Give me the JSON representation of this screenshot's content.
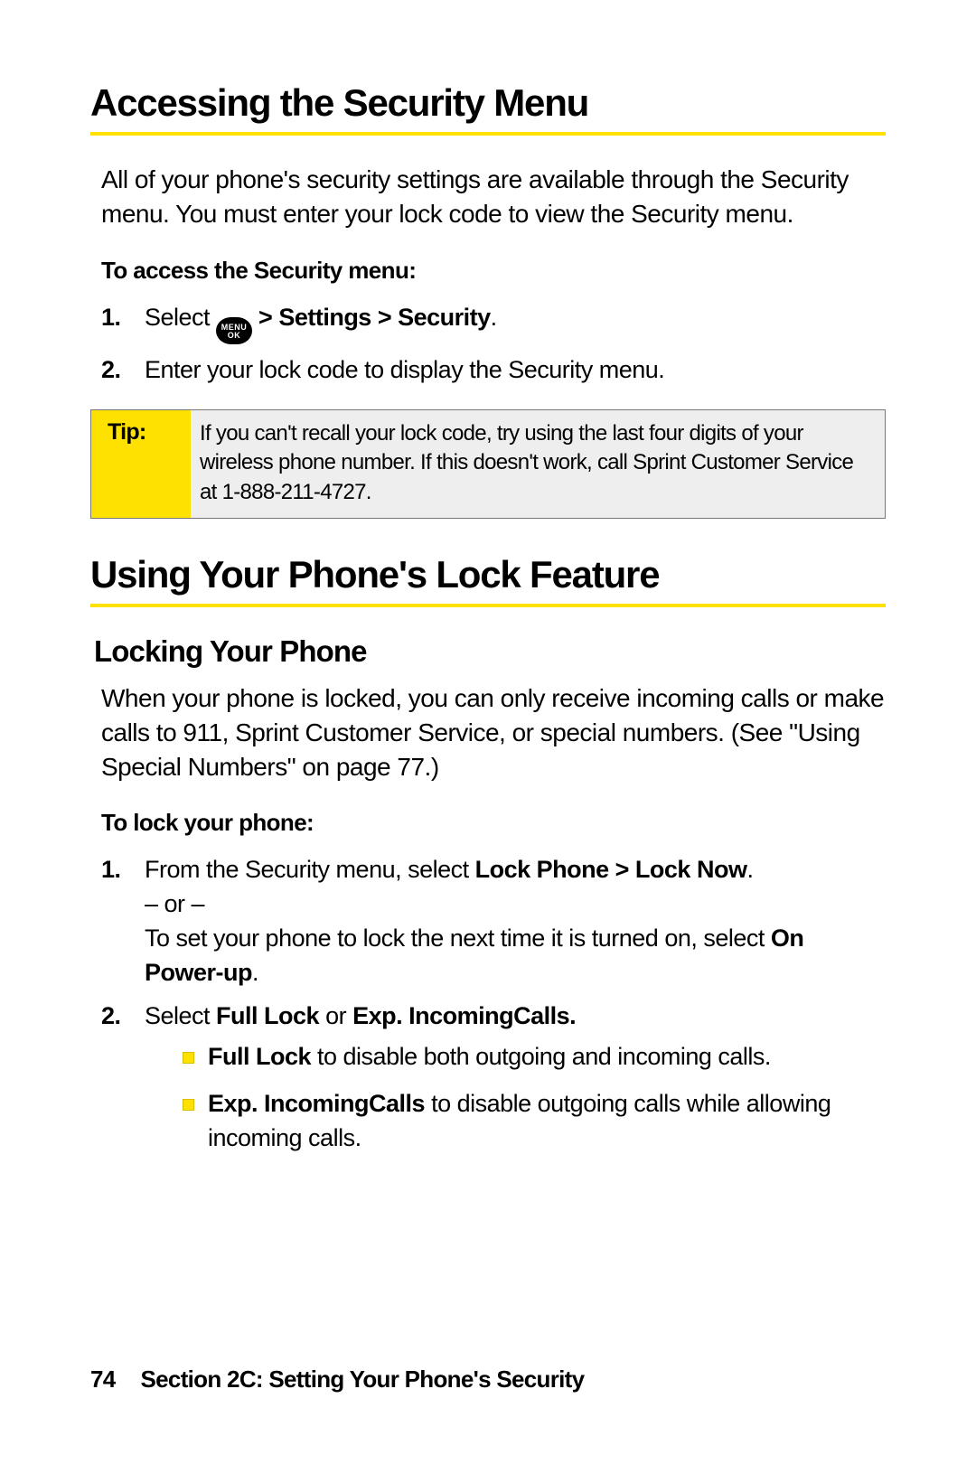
{
  "h1a": "Accessing the Security Menu",
  "intro1": "All of your phone's security settings are available through the Security menu. You must enter your lock code to view the Security menu.",
  "lead1": "To access the Security menu:",
  "step1_pre": "Select ",
  "step1_post": " > Settings > Security",
  "step1_dot": ".",
  "step2": "Enter your lock code to display the Security menu.",
  "tip_label": "Tip:",
  "tip_body": "If you can't recall your lock code, try using the last four digits of your wireless phone number. If this doesn't work, call Sprint Customer Service at 1-888-211-4727.",
  "h1b": "Using Your Phone's Lock Feature",
  "h2a": "Locking Your Phone",
  "intro2": "When your phone is locked, you can only receive incoming calls or make calls to 911, Sprint Customer Service, or special numbers. (See \"Using Special Numbers\" on page 77.)",
  "lead2": "To lock your phone:",
  "lock1_a": "From the Security menu, select ",
  "lock1_b": "Lock Phone > Lock Now",
  "lock1_c": ".",
  "lock1_or": "– or –",
  "lock1_d": "To set your phone to lock the next time it is turned on, select ",
  "lock1_e": "On Power-up",
  "lock1_f": ".",
  "lock2_a": "Select ",
  "lock2_b": "Full Lock",
  "lock2_c": " or ",
  "lock2_d": "Exp. IncomingCalls.",
  "bul1_a": "Full Lock",
  "bul1_b": " to disable both outgoing and incoming calls.",
  "bul2_a": "Exp. IncomingCalls",
  "bul2_b": " to disable outgoing calls while allowing incoming calls.",
  "page_num": "74",
  "section": "Section 2C: Setting Your Phone's Security",
  "icon_top": "MENU",
  "icon_bot": "OK"
}
